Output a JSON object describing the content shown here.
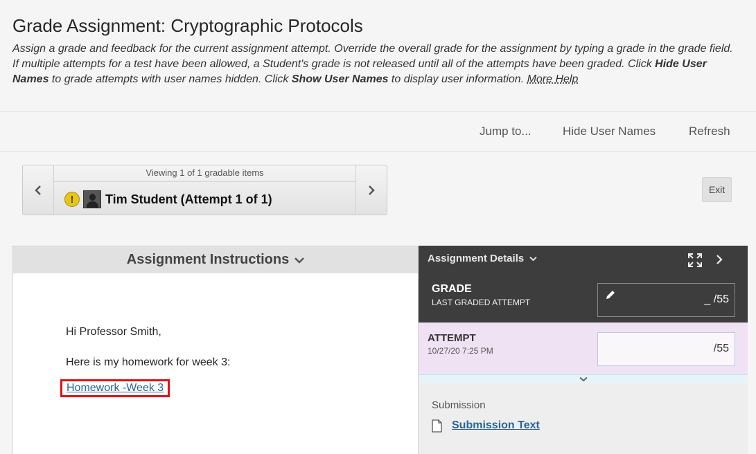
{
  "page": {
    "title": "Grade Assignment: Cryptographic Protocols",
    "desc_part1": "Assign a grade and feedback for the current assignment attempt. Override the overall grade for the assignment by typing a grade in the grade field. If multiple attempts for a test have been allowed, a Student's grade is not released until all of the attempts have been graded. Click ",
    "desc_bold1": "Hide User Names",
    "desc_part2": " to grade attempts with user names hidden. Click ",
    "desc_bold2": "Show User Names",
    "desc_part3": " to display user information. ",
    "more_help": "More Help"
  },
  "toolbar": {
    "jump_to": "Jump to...",
    "hide_user_names": "Hide User Names",
    "refresh": "Refresh"
  },
  "navigator": {
    "viewing": "Viewing 1 of 1 gradable items",
    "warn_glyph": "!",
    "student": "Tim Student (Attempt 1 of 1)"
  },
  "exit_label": "Exit",
  "instructions": {
    "header": "Assignment Instructions",
    "greeting": "Hi Professor Smith,",
    "line": "Here is my homework for week 3:",
    "link": "Homework -Week 3"
  },
  "details": {
    "header": "Assignment Details",
    "grade_label": "GRADE",
    "grade_sub": "LAST GRADED ATTEMPT",
    "grade_value": "_ /55",
    "attempt_label": "ATTEMPT",
    "attempt_date": "10/27/20 7:25 PM",
    "attempt_value": "/55",
    "submission_label": "Submission",
    "submission_link": "Submission Text"
  },
  "colors": {
    "link": "#2a6496",
    "highlight_border": "#e0110f",
    "dark_panel": "#3d3d3d",
    "attempt_bg": "#efe2f2"
  }
}
